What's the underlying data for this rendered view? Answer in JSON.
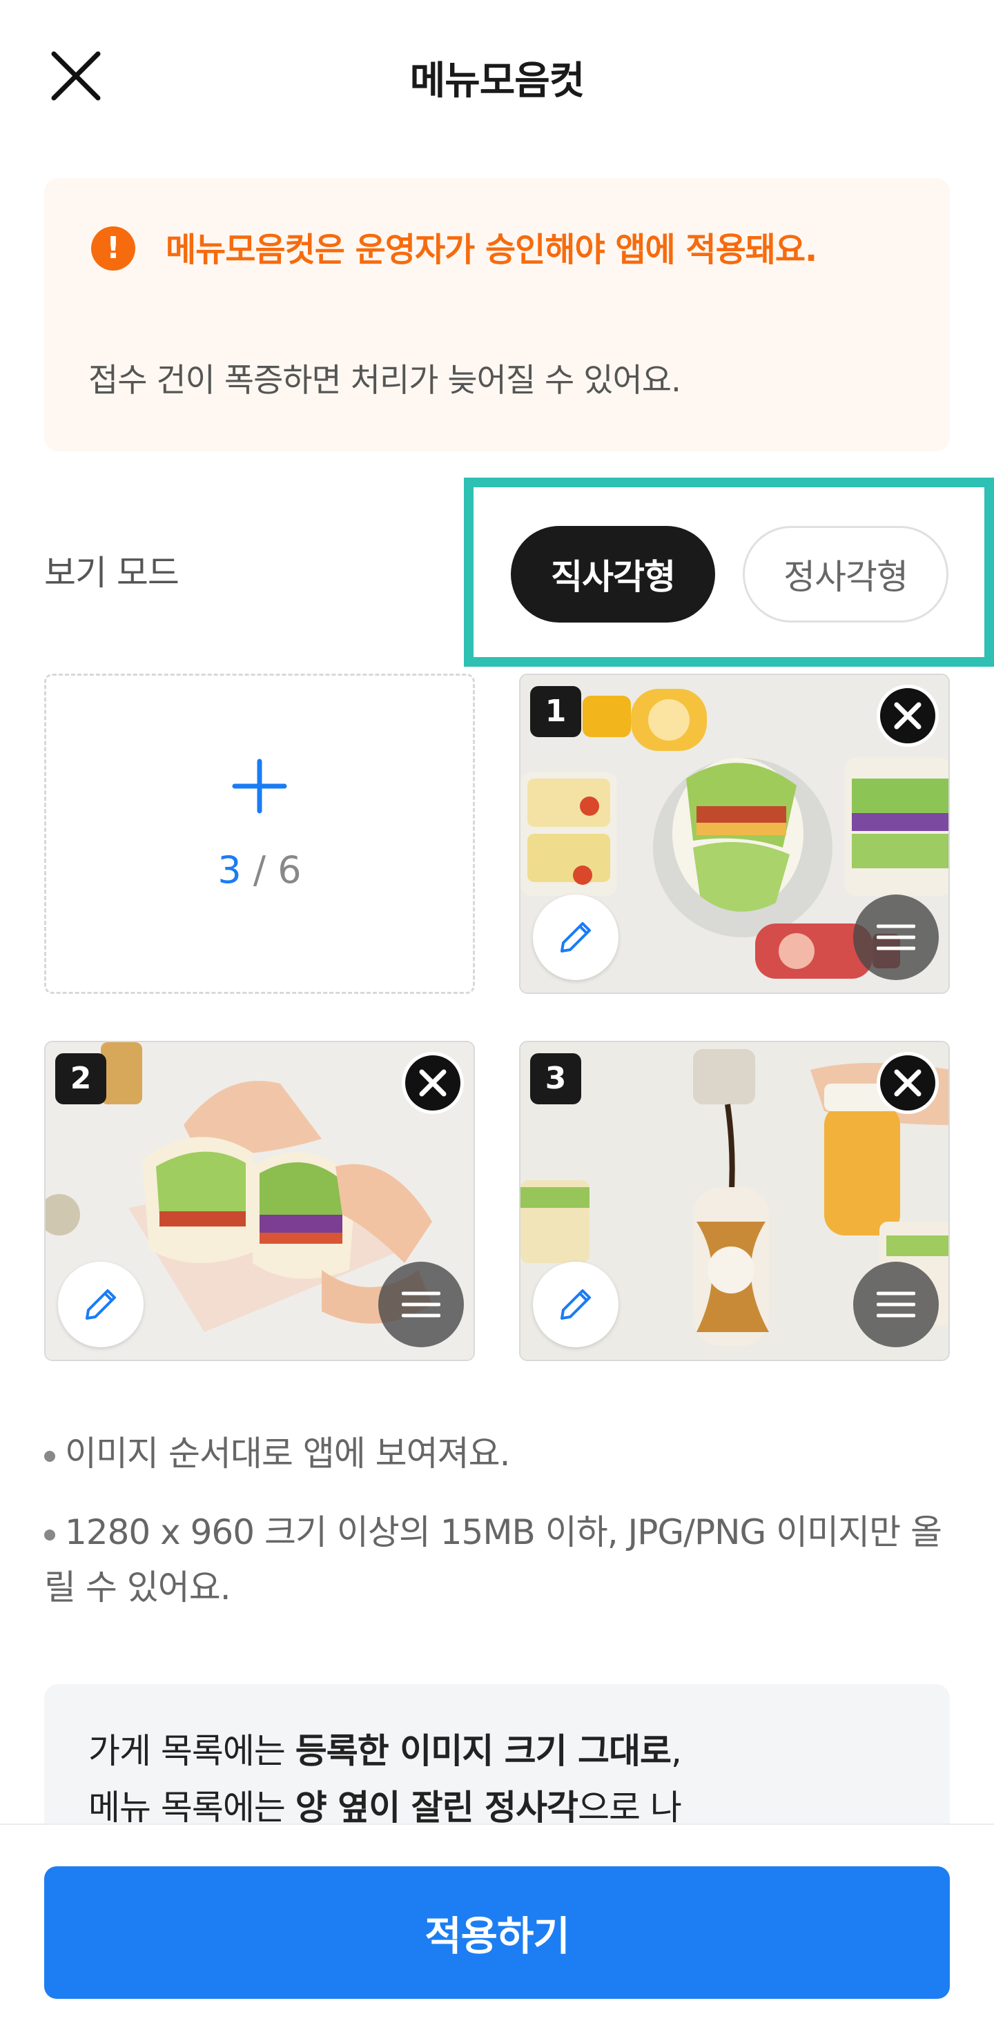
{
  "header": {
    "title": "메뉴모음컷"
  },
  "notice": {
    "title": "메뉴모음컷은 운영자가 승인해야 앱에 적용돼요.",
    "description": "접수 건이 폭증하면 처리가 늦어질 수 있어요.",
    "icon": "exclamation-icon",
    "accent_color": "#f66b0e"
  },
  "view_mode": {
    "label": "보기 모드",
    "options": [
      "직사각형",
      "정사각형"
    ],
    "selected": "직사각형"
  },
  "uploader": {
    "current": "3",
    "separator": " / ",
    "max": "6",
    "photos": [
      {
        "number": "1"
      },
      {
        "number": "2"
      },
      {
        "number": "3"
      }
    ]
  },
  "guides": [
    "이미지 순서대로 앱에 보여져요.",
    "1280 x 960 크기 이상의 15MB 이하, JPG/PNG 이미지만 올릴 수 있어요."
  ],
  "info": {
    "line1_prefix": "가게 목록에는 ",
    "line1_bold": "등록한 이미지 크기 그대로",
    "line1_suffix": ",",
    "line2_prefix": "메뉴 목록에는 ",
    "line2_bold": "양 옆이 잘린 정사각",
    "line2_suffix": "으로 나"
  },
  "footer": {
    "apply_label": "적용하기",
    "button_color": "#1c7ef2"
  },
  "highlight_color": "#2ec0b3"
}
